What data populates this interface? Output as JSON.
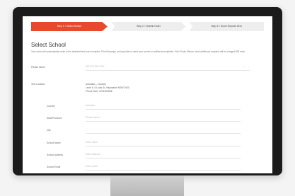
{
  "steps": [
    {
      "label": "Step 1 » Select School"
    },
    {
      "label": "Step 2 » Submit Order"
    },
    {
      "label": "Step 3 » Score Reports Sent"
    }
  ],
  "title": "Select School",
  "intro": "Your score will automatically route to the selected test score recipient. Print this page, and pay later to send your scores to additional recipients. If the South African, send additional recipient will be charged $35 each.",
  "form": {
    "select_label": "Please select",
    "select_placeholder": "SELECTION ONE",
    "sent_label": "Test Location",
    "address": [
      "Australia — Sydney",
      "Level 5, 8 Louis St, Haymarket NSW 2000",
      "Phone Num: 0291002838"
    ],
    "fields": [
      {
        "label": "Country",
        "placeholder": "Australia"
      },
      {
        "label": "State/Province",
        "placeholder": "Please select"
      },
      {
        "label": "City",
        "placeholder": ""
      },
      {
        "label": "School Name",
        "placeholder": "Enter name"
      },
      {
        "label": "School Address",
        "placeholder": "Enter address"
      },
      {
        "label": "School Email",
        "placeholder": "Enter email"
      }
    ]
  },
  "colors": {
    "accent": "#e8492d",
    "bezel": "#1b1b1b"
  }
}
